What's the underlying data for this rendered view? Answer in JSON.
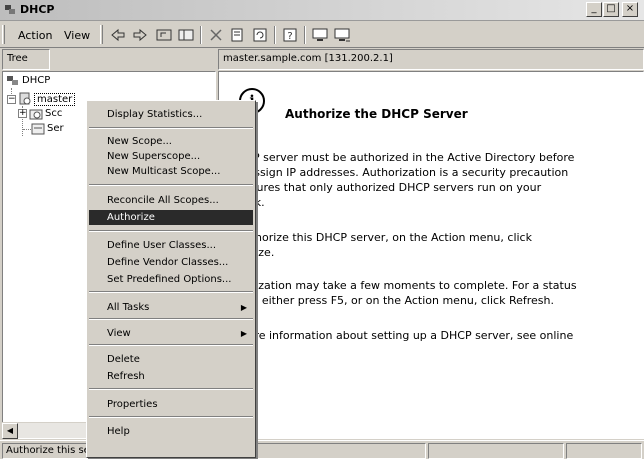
{
  "window": {
    "title": "DHCP",
    "minimize_glyph": "_",
    "maximize_glyph": "□",
    "close_glyph": "×"
  },
  "menubar": {
    "action": "Action",
    "view": "View"
  },
  "tree_pane": {
    "header": "Tree",
    "root": "DHCP",
    "server": "master",
    "child_scope": "Scc",
    "child_server": "Ser"
  },
  "right_pane": {
    "header": "master.sample.com [131.200.2.1]",
    "icon_glyph": "i",
    "title": "Authorize the DHCP Server",
    "paragraph1_line1": "HCP server must be authorized in the Active Directory before",
    "paragraph1_line2": "n assign IP addresses. Authorization is a security precaution",
    "paragraph1_line3": "ensures that only authorized DHCP servers run on your",
    "paragraph1_line4": "vork.",
    "paragraph2_line1": "authorize this DHCP server, on the Action menu, click",
    "paragraph2_line2": "norize.",
    "paragraph3_line1": "norization may take a few moments to complete. For a status",
    "paragraph3_line2": "ate, either press F5, or on the Action menu, click Refresh.",
    "paragraph4_line1": "more information about setting up a DHCP server, see online"
  },
  "context_menu": {
    "display_statistics": "Display Statistics...",
    "new_scope": "New Scope...",
    "new_superscope": "New Superscope...",
    "new_multicast_scope": "New Multicast Scope...",
    "reconcile_all_scopes": "Reconcile All Scopes...",
    "authorize": "Authorize",
    "define_user_classes": "Define User Classes...",
    "define_vendor_classes": "Define Vendor Classes...",
    "set_predefined_options": "Set Predefined Options...",
    "all_tasks": "All Tasks",
    "view": "View",
    "delete": "Delete",
    "refresh": "Refresh",
    "properties": "Properties",
    "help": "Help",
    "submenu_arrow": "▶"
  },
  "statusbar": {
    "text": "Authorize this server in the directory"
  },
  "scroll": {
    "left_arrow": "◀",
    "right_arrow": "▶"
  }
}
